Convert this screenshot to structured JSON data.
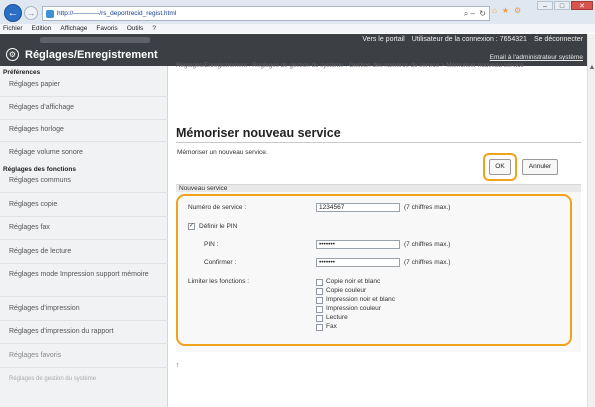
{
  "browser": {
    "url": "http://————/rs_deportrecid_regist.html",
    "menu": [
      "Fichier",
      "Edition",
      "Affichage",
      "Favoris",
      "Outils",
      "?"
    ],
    "search_glyph": "⌕ –",
    "refresh_glyph": "↻",
    "tab_icons": [
      "⌂",
      "★",
      "⚙"
    ],
    "win_controls": [
      "–",
      "□",
      "✕"
    ]
  },
  "header": {
    "icon_glyph": "⚙",
    "title": "Réglages/Enregistrement",
    "links": [
      "Vers le portail",
      "Utilisateur de la connexion : 7654321",
      "Se déconnecter"
    ],
    "admin_email": "Email à l'administrateur système"
  },
  "sidebar": {
    "section_preferences": "Préférences",
    "preferences": [
      "Réglages papier",
      "Réglages d'affichage",
      "Réglages horloge",
      "Réglage volume sonore"
    ],
    "section_functions": "Réglages des fonctions",
    "functions": [
      "Réglages communs",
      "Réglages copie",
      "Réglages fax",
      "Réglages de lecture",
      "Réglages mode Impression support mémoire",
      "Réglages d'impression",
      "Réglages d'impression du rapport",
      "Réglages favoris",
      "Réglages de gestion du système"
    ]
  },
  "main": {
    "breadcrumb": "Réglages/Enregistrement : Réglages de gestion du système : Gestion des numéros de service > Mémoriser nouveau service",
    "title": "Mémoriser nouveau service",
    "description": "Mémoriser un nouveau service.",
    "ok_label": "OK",
    "cancel_label": "Annuler",
    "section_label": "Nouveau service",
    "top_link_glyph": "↑"
  },
  "form": {
    "service_label": "Numéro de service :",
    "service_value": "1234567",
    "service_hint": "(7 chiffres max.)",
    "set_pin_checked": true,
    "set_pin_label": "Définir le PIN",
    "pin_label": "PIN :",
    "pin_value": "•••••••",
    "pin_hint": "(7 chiffres max.)",
    "confirm_label": "Confirmer :",
    "confirm_value": "•••••••",
    "confirm_hint": "(7 chiffres max.)",
    "restrict_label": "Limiter les fonctions :",
    "restrictions": [
      {
        "label": "Copie noir et blanc",
        "checked": false
      },
      {
        "label": "Copie couleur",
        "checked": false
      },
      {
        "label": "Impression noir et blanc",
        "checked": false
      },
      {
        "label": "Impression couleur",
        "checked": false
      },
      {
        "label": "Lecture",
        "checked": false
      },
      {
        "label": "Fax",
        "checked": false
      }
    ]
  },
  "colors": {
    "highlight": "#f0a21b",
    "header_bg": "#3c3f44",
    "sidebar_bg": "#f1f2f3"
  }
}
